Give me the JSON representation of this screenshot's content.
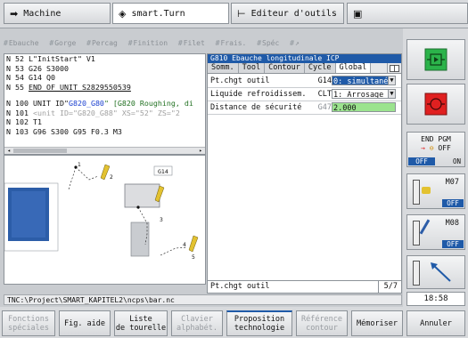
{
  "tabs": [
    {
      "label": "Machine",
      "icon": "arrow-right-icon"
    },
    {
      "label": "smart.Turn",
      "icon": "diamond-arrow-icon"
    },
    {
      "label": "Editeur d'outils",
      "icon": "tool-editor-icon"
    },
    {
      "label": "",
      "icon": "save-icon"
    }
  ],
  "softkey_row": [
    "Ebauche",
    "Gorge",
    "Percag",
    "Finition",
    "Filet",
    "Frais.",
    "Spéc"
  ],
  "nc_program": {
    "lines": [
      {
        "n": "N",
        "num": "52",
        "text": "L\"InitStart\" V1"
      },
      {
        "n": "N",
        "num": "53",
        "text": "G26 S3000"
      },
      {
        "n": "N",
        "num": "54",
        "text": "G14 Q0"
      },
      {
        "n": "N",
        "num": "55",
        "text": "END_OF_UNIT S2829550539"
      },
      {
        "n": "N",
        "num": "100",
        "pre": "UNIT ID\"",
        "id": "G820_G80",
        "post": "\" [G820 Roughing, di"
      },
      {
        "n": "N",
        "num": "101",
        "text": "<unit ID=\"G820_G88\" XS=\"52\" ZS=\"2"
      },
      {
        "n": "N",
        "num": "102",
        "text": "T1"
      },
      {
        "n": "N",
        "num": "103",
        "text": "G96 S300 G95 F0.3 M3"
      }
    ]
  },
  "graphic": {
    "label": "G14"
  },
  "form": {
    "title": "G810 Ebauche longitudinale ICP",
    "tabs": [
      "Somm.",
      "Tool",
      "Contour",
      "Cycle",
      "Global"
    ],
    "active_tab": "Global",
    "fields": [
      {
        "label": "Pt.chgt outil",
        "code": "G14",
        "value": "0: simultané"
      },
      {
        "label": "Liquide refroidissem.",
        "code": "CLT",
        "value": "1: Arrosage 1"
      },
      {
        "label": "Distance de sécurité",
        "code": "G47",
        "value": "2.000"
      }
    ],
    "status_label": "Pt.chgt outil",
    "page": "5/7"
  },
  "path": "TNC:\\Project\\SMART_KAPITEL2\\ncps\\bar.nc",
  "bottom_keys": [
    {
      "lines": [
        "Fonctions",
        "spéciales"
      ],
      "enabled": false
    },
    {
      "lines": [
        "Fig. aide"
      ],
      "enabled": true
    },
    {
      "lines": [
        "Liste",
        "de tourelle"
      ],
      "enabled": true
    },
    {
      "lines": [
        "Clavier",
        "alphabét."
      ],
      "enabled": false
    },
    {
      "lines": [
        "Proposition",
        "technologie"
      ],
      "enabled": true
    },
    {
      "lines": [
        "Référence",
        "contour"
      ],
      "enabled": false
    },
    {
      "lines": [
        "Mémoriser"
      ],
      "enabled": true
    },
    {
      "lines": [
        "Annuler"
      ],
      "enabled": true
    }
  ],
  "right_panel": {
    "end_pgm": "END PGM",
    "off": "OFF",
    "on": "ON",
    "m07": "M07",
    "m08": "M08",
    "time": "18:58"
  },
  "colors": {
    "accent": "#1f5aa8",
    "green": "#9be38e",
    "ok_green": "#2bb34a",
    "stop_red": "#e02020"
  }
}
